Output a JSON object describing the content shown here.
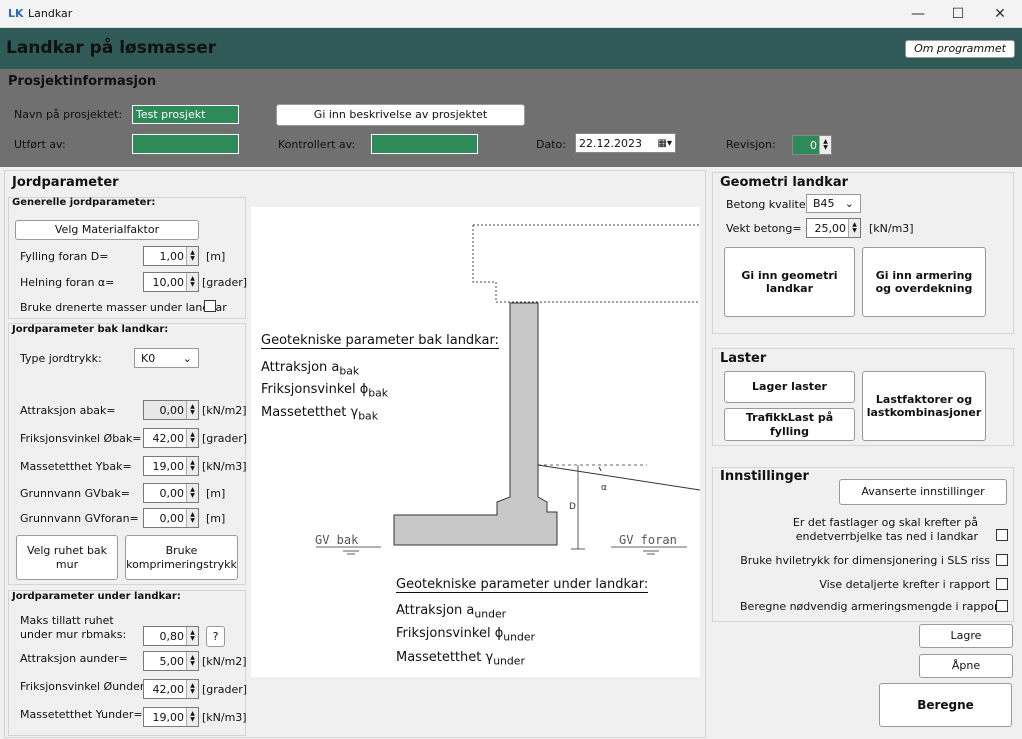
{
  "window": {
    "logo": "LK",
    "title": "Landkar",
    "minimize": "—",
    "maximize": "☐",
    "close": "✕"
  },
  "header": {
    "title": "Landkar på løsmasser",
    "about_label": "Om programmet"
  },
  "project": {
    "section_title": "Prosjektinformasjon",
    "name_label": "Navn på prosjektet:",
    "name_value": "Test prosjekt",
    "description_button": "Gi inn beskrivelse av prosjektet",
    "done_by_label": "Utført av:",
    "done_by_value": "",
    "checked_by_label": "Kontrollert av:",
    "checked_by_value": "",
    "date_label": "Dato:",
    "date_value": "22.12.2023",
    "revision_label": "Revisjon:",
    "revision_value": "0"
  },
  "soil": {
    "section_title": "Jordparameter",
    "general_title": "Generelle jordparameter:",
    "material_factor_button": "Velg Materialfaktor",
    "fill_front_label": "Fylling foran D=",
    "fill_front_value": "1,00",
    "fill_front_unit": "[m]",
    "slope_front_label": "Helning foran α=",
    "slope_front_value": "10,00",
    "slope_front_unit": "[grader]",
    "drained_label": "Bruke drenerte masser under landkar",
    "behind_title": "Jordparameter bak landkar:",
    "earth_pressure_label": "Type jordtrykk:",
    "earth_pressure_value": "K0",
    "attraction_back_label": "Attraksjon abak=",
    "attraction_back_value": "0,00",
    "attraction_back_unit": "[kN/m2]",
    "friction_back_label": "Friksjonsvinkel Øbak=",
    "friction_back_value": "42,00",
    "friction_back_unit": "[grader]",
    "density_back_label": "Massetetthet Ybak=",
    "density_back_value": "19,00",
    "density_back_unit": "[kN/m3]",
    "gw_back_label": "Grunnvann GVbak=",
    "gw_back_value": "0,00",
    "gw_back_unit": "[m]",
    "gw_front_label": "Grunnvann GVforan=",
    "gw_front_value": "0,00",
    "gw_front_unit": "[m]",
    "roughness_button": "Velg ruhet bak mur",
    "compaction_button": "Bruke komprimeringstrykk",
    "under_title": "Jordparameter under landkar:",
    "max_rough_label": "Maks tillatt ruhet under mur rbmaks:",
    "max_rough_value": "0,80",
    "help_button": "?",
    "attraction_under_label": "Attraksjon aunder=",
    "attraction_under_value": "5,00",
    "attraction_under_unit": "[kN/m2]",
    "friction_under_label": "Friksjonsvinkel Øunder=",
    "friction_under_value": "42,00",
    "friction_under_unit": "[grader]",
    "density_under_label": "Massetetthet Yunder=",
    "density_under_value": "19,00",
    "density_under_unit": "[kN/m3]"
  },
  "diagram": {
    "behind_heading": "Geotekniske parameter bak landkar:",
    "behind_attr": "Attraksjon a",
    "behind_attr_sub": "bak",
    "behind_fric": "Friksjonsvinkel ϕ",
    "behind_fric_sub": "bak",
    "behind_dens": "Massetetthet γ",
    "behind_dens_sub": "bak",
    "under_heading": "Geotekniske parameter under landkar:",
    "under_attr": "Attraksjon a",
    "under_attr_sub": "under",
    "under_fric": "Friksjonsvinkel ϕ",
    "under_fric_sub": "under",
    "under_dens": "Massetetthet γ",
    "under_dens_sub": "under",
    "gv_back": "GV bak",
    "gv_front": "GV foran",
    "d_label": "D",
    "alpha_label": "α"
  },
  "geometry": {
    "section_title": "Geometri landkar",
    "concrete_label": "Betong kvalitet:",
    "concrete_value": "B45",
    "weight_label": "Vekt betong=",
    "weight_value": "25,00",
    "weight_unit": "[kN/m3]",
    "geometry_button": "Gi inn geometri landkar",
    "reinforcement_button": "Gi inn armering og overdekning"
  },
  "loads": {
    "section_title": "Laster",
    "create_button": "Lager laster",
    "traffic_button": "TrafikkLast på fylling",
    "factors_button": "Lastfaktorer og lastkombinasjoner"
  },
  "settings": {
    "section_title": "Innstillinger",
    "advanced_button": "Avanserte innstillinger",
    "opt1": "Er det fastlager og skal krefter på endetverrbjelke tas ned i landkar",
    "opt2": "Bruke hviletrykk for dimensjonering i SLS riss",
    "opt3": "Vise detaljerte krefter i rapport",
    "opt4": "Beregne nødvendig armeringsmengde i rapport"
  },
  "actions": {
    "save": "Lagre",
    "open": "Åpne",
    "calculate": "Beregne"
  }
}
